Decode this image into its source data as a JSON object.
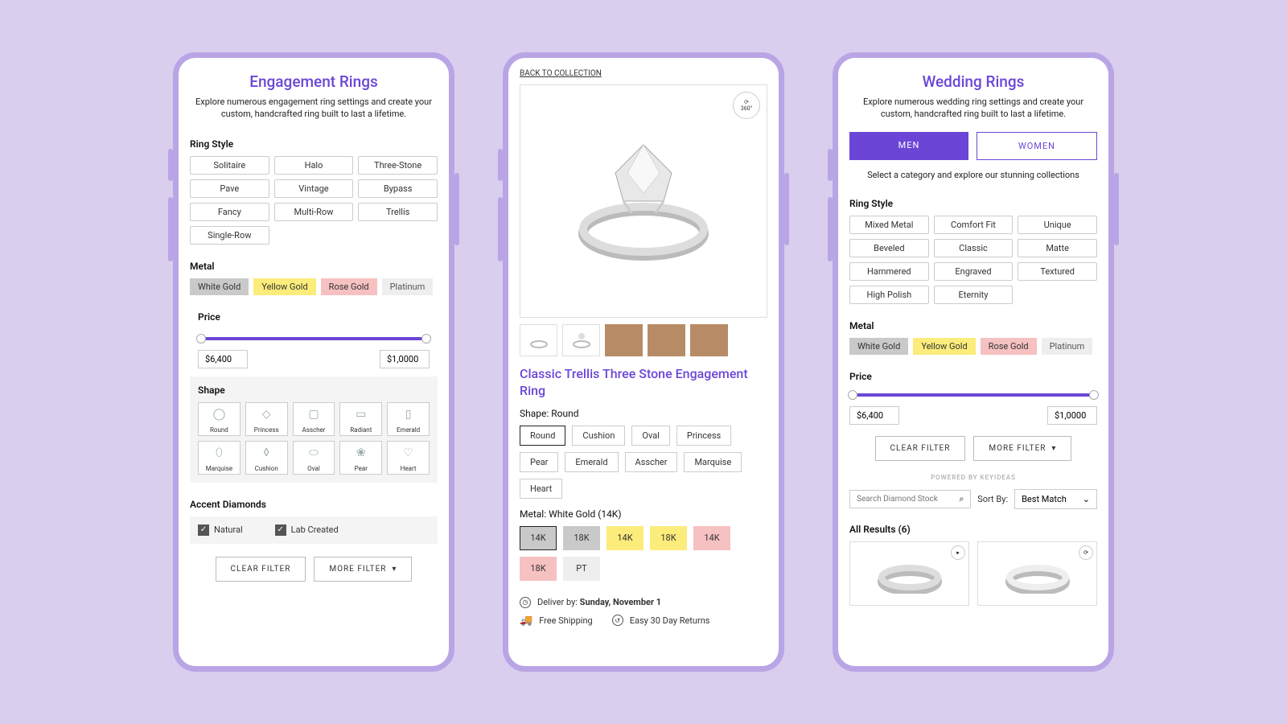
{
  "panel1": {
    "title": "Engagement Rings",
    "subtitle": "Explore numerous engagement ring settings and create your custom, handcrafted ring built to last a lifetime.",
    "ring_style_label": "Ring Style",
    "styles": [
      "Solitaire",
      "Halo",
      "Three-Stone",
      "Pave",
      "Vintage",
      "Bypass",
      "Fancy",
      "Multi-Row",
      "Trellis",
      "Single-Row"
    ],
    "metal_label": "Metal",
    "metals": [
      "White Gold",
      "Yellow Gold",
      "Rose Gold",
      "Platinum"
    ],
    "price_label": "Price",
    "price_min": "$6,400",
    "price_max": "$1,0000",
    "shape_label": "Shape",
    "shapes": [
      "Round",
      "Princess",
      "Asscher",
      "Radiant",
      "Emerald",
      "Marquise",
      "Cushion",
      "Oval",
      "Pear",
      "Heart"
    ],
    "accent_label": "Accent Diamonds",
    "accent_natural": "Natural",
    "accent_lab": "Lab Created",
    "clear_filter": "CLEAR FILTER",
    "more_filter": "MORE FILTER"
  },
  "panel2": {
    "back": "BACK TO COLLECTION",
    "badge": "360°",
    "title": "Classic Trellis Three Stone Engagement Ring",
    "shape_label": "Shape: Round",
    "shapes": [
      "Round",
      "Cushion",
      "Oval",
      "Princess",
      "Pear",
      "Emerald",
      "Asscher",
      "Marquise",
      "Heart"
    ],
    "shape_selected": "Round",
    "metal_label": "Metal: White Gold (14K)",
    "metal_swatches": [
      {
        "label": "14K",
        "bg": "#c9c9c9",
        "sel": true
      },
      {
        "label": "18K",
        "bg": "#c9c9c9"
      },
      {
        "label": "14K",
        "bg": "#fcec7b"
      },
      {
        "label": "18K",
        "bg": "#fcec7b"
      },
      {
        "label": "14K",
        "bg": "#f6c1c1"
      },
      {
        "label": "18K",
        "bg": "#f6c1c1"
      },
      {
        "label": "PT",
        "bg": "#eee"
      }
    ],
    "deliver_prefix": "Deliver by: ",
    "deliver_date": "Sunday, November 1",
    "shipping": "Free Shipping",
    "returns": "Easy 30 Day Returns"
  },
  "panel3": {
    "title": "Wedding Rings",
    "subtitle": "Explore numerous wedding ring settings and create your custom, handcrafted ring built to last a lifetime.",
    "seg_men": "MEN",
    "seg_women": "WOMEN",
    "selectline": "Select a category and explore our stunning collections",
    "ring_style_label": "Ring Style",
    "styles": [
      "Mixed Metal",
      "Comfort Fit",
      "Unique",
      "Beveled",
      "Classic",
      "Matte",
      "Hammered",
      "Engraved",
      "Textured",
      "High Polish",
      "Eternity"
    ],
    "metal_label": "Metal",
    "metals": [
      "White Gold",
      "Yellow Gold",
      "Rose Gold",
      "Platinum"
    ],
    "price_label": "Price",
    "price_min": "$6,400",
    "price_max": "$1,0000",
    "clear_filter": "CLEAR FILTER",
    "more_filter": "MORE FILTER",
    "powered": "POWERED BY KEYIDEAS",
    "search_ph": "Search Diamond Stock",
    "sort_label": "Sort By:",
    "sort_value": "Best Match",
    "results_label": "All Results (6)"
  }
}
